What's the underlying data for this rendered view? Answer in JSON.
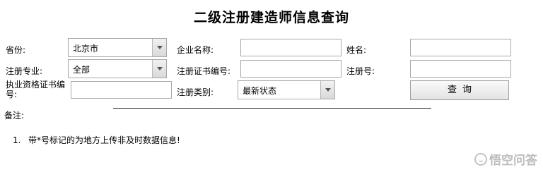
{
  "page": {
    "title": "二级注册建造师信息查询"
  },
  "form": {
    "province_label": "省份:",
    "province_value": "北京市",
    "company_label": "企业名称:",
    "company_value": "",
    "name_label": "姓名:",
    "name_value": "",
    "major_label": "注册专业:",
    "major_value": "全部",
    "cert_no_label": "注册证书编号:",
    "cert_no_value": "",
    "reg_no_label": "注册号:",
    "reg_no_value": "",
    "qual_cert_label": "执业资格证书编号:",
    "qual_cert_value": "",
    "reg_type_label": "注册类别:",
    "reg_type_value": "最新状态",
    "query_button": "查询"
  },
  "notes": {
    "title": "备注:",
    "items": [
      {
        "num": "1.",
        "text": "带*号标记的为地方上传非及时数据信息!"
      }
    ]
  },
  "watermark": {
    "text": "悟空问答"
  }
}
